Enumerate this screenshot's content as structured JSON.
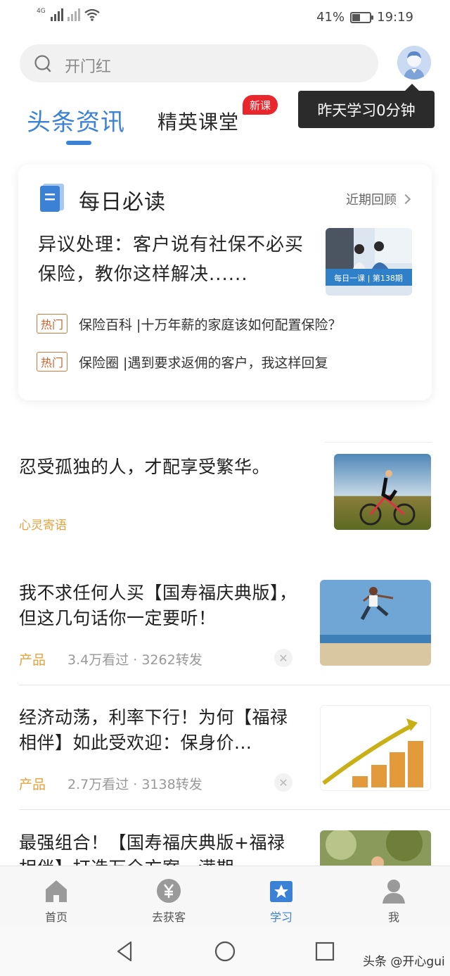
{
  "status_bar": {
    "network_1": "4G",
    "battery_percent": "41%",
    "battery_level": 0.41,
    "time": "19:19",
    "icons": [
      "signal-icon",
      "signal-muted-icon",
      "wifi-icon",
      "battery-icon"
    ]
  },
  "search": {
    "placeholder": "开门红"
  },
  "tooltip": {
    "text": "昨天学习0分钟"
  },
  "tabs": {
    "active": "头条资讯",
    "second": "精英课堂",
    "second_badge": "新课"
  },
  "daily": {
    "title": "每日必读",
    "recent_label": "近期回顾",
    "lead_title": "异议处理：客户说有社保不必买保险，教你这样解决......",
    "lead_thumb_caption": "每日一课 | 第138期",
    "hot_items": [
      {
        "tag": "热门",
        "text": "保险百科 |十万年薪的家庭该如何配置保险？"
      },
      {
        "tag": "热门",
        "text": "保险圈 |遇到要求返佣的客户，我这样回复"
      }
    ]
  },
  "feed": [
    {
      "title": "忍受孤独的人，才配享受繁华。",
      "category": "心灵寄语",
      "meta": ""
    },
    {
      "title": "我不求任何人买【国寿福庆典版】，但这几句话你一定要听！",
      "category": "产品",
      "meta": "3.4万看过 · 3262转发"
    },
    {
      "title": "经济动荡，利率下行！为何【福禄相伴】如此受欢迎：保身价...",
      "category": "产品",
      "meta": "2.7万看过 · 3138转发"
    },
    {
      "title": "最强组合！【国寿福庆典版+福禄相伴】打造万全方案，满期",
      "category": "",
      "meta": ""
    }
  ],
  "bottom_nav": [
    {
      "label": "首页",
      "icon": "home-icon",
      "active": false
    },
    {
      "label": "去获客",
      "icon": "yuan-icon",
      "active": false
    },
    {
      "label": "学习",
      "icon": "star-badge-icon",
      "active": true
    },
    {
      "label": "我",
      "icon": "person-icon",
      "active": false
    }
  ],
  "watermark": "头条 @开心gui",
  "colors": {
    "accent": "#3b82d6",
    "badge_red": "#e8262c",
    "hot_orange": "#d0602a",
    "category_gold": "#e6a23c"
  }
}
